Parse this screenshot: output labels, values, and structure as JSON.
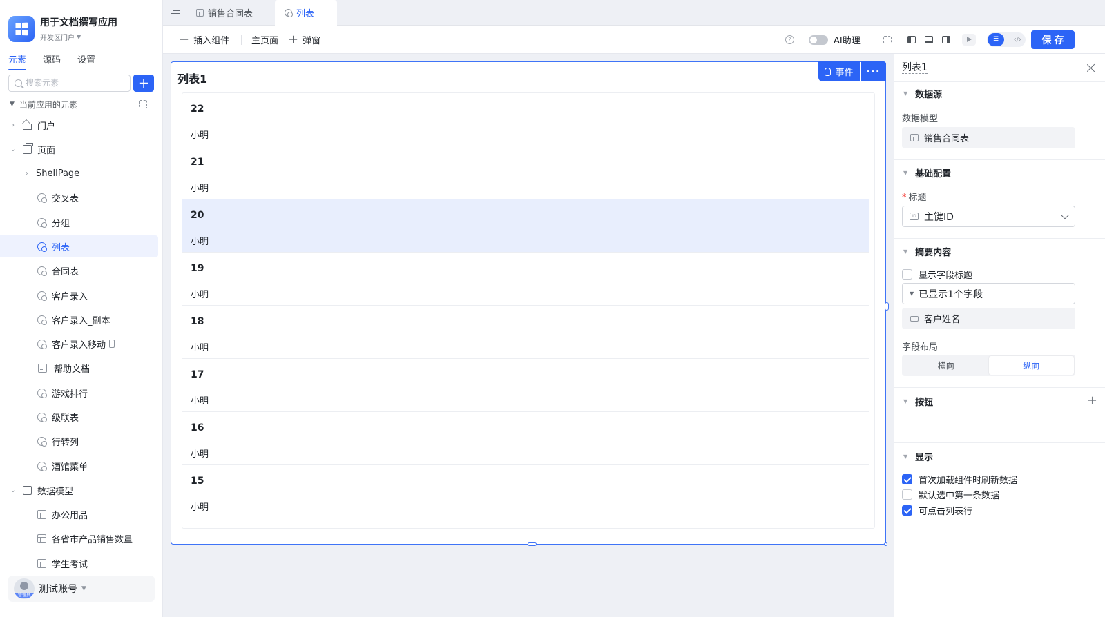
{
  "app": {
    "title": "用于文档撰写应用",
    "portal": "开发区门户"
  },
  "sidebar": {
    "tabs": [
      "元素",
      "源码",
      "设置"
    ],
    "search_placeholder": "搜索元素",
    "section_title": "当前应用的元素",
    "tree": [
      {
        "label": "门户",
        "icon": "home-icon",
        "level": 0,
        "expand": "collapsed"
      },
      {
        "label": "页面",
        "icon": "pages-icon",
        "level": 0,
        "expand": "expanded"
      },
      {
        "label": "ShellPage",
        "icon": "",
        "level": 1,
        "expand": "collapsed"
      },
      {
        "label": "交叉表",
        "icon": "page-icon",
        "level": 2
      },
      {
        "label": "分组",
        "icon": "page-icon",
        "level": 2
      },
      {
        "label": "列表",
        "icon": "page-icon",
        "level": 2,
        "selected": true
      },
      {
        "label": "合同表",
        "icon": "page-icon",
        "level": 2
      },
      {
        "label": "客户录入",
        "icon": "page-icon",
        "level": 2
      },
      {
        "label": "客户录入_副本",
        "icon": "page-icon",
        "level": 2
      },
      {
        "label": "客户录入移动",
        "icon": "page-icon",
        "level": 2,
        "mobile": true
      },
      {
        "label": "帮助文档",
        "icon": "doc-icon",
        "level": 2
      },
      {
        "label": "游戏排行",
        "icon": "page-icon",
        "level": 2
      },
      {
        "label": "级联表",
        "icon": "page-icon",
        "level": 2
      },
      {
        "label": "行转列",
        "icon": "page-icon",
        "level": 2
      },
      {
        "label": "酒馆菜单",
        "icon": "page-icon",
        "level": 2
      },
      {
        "label": "数据模型",
        "icon": "table-icon",
        "level": 0,
        "expand": "expanded"
      },
      {
        "label": "办公用品",
        "icon": "table-icon",
        "level": 2
      },
      {
        "label": "各省市产品销售数量",
        "icon": "table-icon",
        "level": 2
      },
      {
        "label": "学生考试",
        "icon": "table-icon",
        "level": 2
      }
    ],
    "account": {
      "name": "测试账号",
      "badge": "管理员"
    }
  },
  "tabs": [
    {
      "label": "销售合同表",
      "icon": "table-icon",
      "active": false
    },
    {
      "label": "列表",
      "icon": "page-icon",
      "active": true
    }
  ],
  "toolbar": {
    "insert": "插入组件",
    "main_page": "主页面",
    "popup": "弹窗",
    "ai": "AI助理",
    "save": "保存"
  },
  "canvas": {
    "list_title": "列表1",
    "event_label": "事件",
    "more_label": "···",
    "rows": [
      {
        "id": "22",
        "name": "小明"
      },
      {
        "id": "21",
        "name": "小明"
      },
      {
        "id": "20",
        "name": "小明",
        "highlight": true
      },
      {
        "id": "19",
        "name": "小明"
      },
      {
        "id": "18",
        "name": "小明"
      },
      {
        "id": "17",
        "name": "小明"
      },
      {
        "id": "16",
        "name": "小明"
      },
      {
        "id": "15",
        "name": "小明"
      }
    ]
  },
  "panel": {
    "title": "列表1",
    "datasource": {
      "section": "数据源",
      "model_label": "数据模型",
      "model_value": "销售合同表"
    },
    "basic": {
      "section": "基础配置",
      "title_label": "标题",
      "title_value": "主键ID"
    },
    "summary": {
      "section": "摘要内容",
      "show_field_title": "显示字段标题",
      "show_field_title_checked": false,
      "shown_fields": "已显示1个字段",
      "field": "客户姓名",
      "layout_label": "字段布局",
      "layout_options": [
        "横向",
        "纵向"
      ],
      "layout_selected": "纵向"
    },
    "buttons": {
      "section": "按钮"
    },
    "display": {
      "section": "显示",
      "options": [
        {
          "label": "首次加载组件时刷新数据",
          "checked": true
        },
        {
          "label": "默认选中第一条数据",
          "checked": false
        },
        {
          "label": "可点击列表行",
          "checked": true
        }
      ]
    }
  },
  "colors": {
    "accent": "#2c64f6",
    "selected_row": "#e8eefd",
    "sidebar_selected": "#eef2fe"
  }
}
